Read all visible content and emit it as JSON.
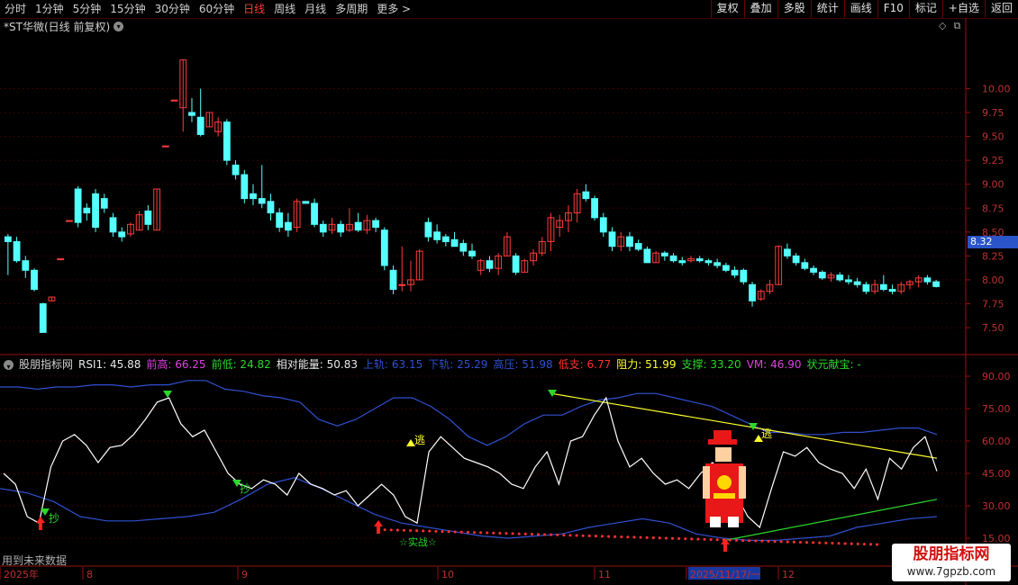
{
  "toolbar": {
    "periods": [
      {
        "label": "分时",
        "active": false
      },
      {
        "label": "1分钟",
        "active": false
      },
      {
        "label": "5分钟",
        "active": false
      },
      {
        "label": "15分钟",
        "active": false
      },
      {
        "label": "30分钟",
        "active": false
      },
      {
        "label": "60分钟",
        "active": false
      },
      {
        "label": "日线",
        "active": true
      },
      {
        "label": "周线",
        "active": false
      },
      {
        "label": "月线",
        "active": false
      },
      {
        "label": "多周期",
        "active": false
      },
      {
        "label": "更多 >",
        "active": false
      }
    ],
    "buttons": [
      "复权",
      "叠加",
      "多股",
      "统计",
      "画线",
      "F10",
      "标记",
      "+自选",
      "返回"
    ]
  },
  "main_title": "*ST华微(日线 前复权)",
  "corner_icons": [
    "diamond-icon",
    "restore-icon"
  ],
  "price_tag": "8.32",
  "indicator": {
    "name": "股朋指标网",
    "fields": [
      {
        "label": "RSI1: 45.88",
        "color": "#e8e8e8"
      },
      {
        "label": "前高: 66.25",
        "color": "#e040e0"
      },
      {
        "label": "前低: 24.82",
        "color": "#2ad82a"
      },
      {
        "label": "相对能量: 50.83",
        "color": "#e8e8e8"
      },
      {
        "label": "上轨: 63.15",
        "color": "#3050d0"
      },
      {
        "label": "下轨: 25.29",
        "color": "#3050d0"
      },
      {
        "label": "高压: 51.98",
        "color": "#3050d0"
      },
      {
        "label": "低支: 6.77",
        "color": "#ff3030"
      },
      {
        "label": "阻力: 51.99",
        "color": "#ffff30"
      },
      {
        "label": "支撑: 33.20",
        "color": "#2ad82a"
      },
      {
        "label": "VM: 46.90",
        "color": "#e040e0"
      },
      {
        "label": "状元献宝: -",
        "color": "#2ad82a"
      }
    ]
  },
  "annotations": {
    "chao": "抄",
    "tao": "逃",
    "shizhan": "☆实战☆"
  },
  "future_note": "用到未来数据",
  "watermark": {
    "line1": "股朋指标网",
    "line2": "www.7gpzb.com"
  },
  "date_axis": {
    "labels": [
      "2025年",
      "8",
      "9",
      "10",
      "11",
      "2025/11/17/一",
      "12"
    ]
  },
  "chart_data": [
    {
      "type": "candlestick",
      "title": "*ST华微(日线 前复权)",
      "y_ticks": [
        7.5,
        7.75,
        8.0,
        8.25,
        8.5,
        8.75,
        9.0,
        9.25,
        9.5,
        9.75,
        10.0
      ],
      "ylim": [
        7.35,
        10.55
      ],
      "colors": {
        "up": "#ff3c3c",
        "down": "#54ffff"
      },
      "candles": [
        [
          8.45,
          8.05,
          8.4,
          8.48
        ],
        [
          8.4,
          8.18,
          8.2,
          8.45
        ],
        [
          8.2,
          8.02,
          8.1,
          8.25
        ],
        [
          8.1,
          7.88,
          7.9,
          8.12
        ],
        [
          7.75,
          7.45,
          7.45,
          7.76
        ],
        [
          7.78,
          7.78,
          7.82,
          7.82
        ],
        [
          8.22,
          8.22,
          8.22,
          8.22
        ],
        [
          8.62,
          8.62,
          8.62,
          8.62
        ],
        [
          8.95,
          8.55,
          8.6,
          8.98
        ],
        [
          8.75,
          8.62,
          8.7,
          8.8
        ],
        [
          8.9,
          8.5,
          8.55,
          8.95
        ],
        [
          8.85,
          8.7,
          8.75,
          8.9
        ],
        [
          8.65,
          8.45,
          8.5,
          8.7
        ],
        [
          8.5,
          8.4,
          8.45,
          8.55
        ],
        [
          8.48,
          8.45,
          8.58,
          8.6
        ],
        [
          8.52,
          8.52,
          8.68,
          8.72
        ],
        [
          8.72,
          8.52,
          8.58,
          8.78
        ],
        [
          8.52,
          8.52,
          8.95,
          8.95
        ],
        [
          9.4,
          9.4,
          9.4,
          9.4
        ],
        [
          9.88,
          9.88,
          9.88,
          9.88
        ],
        [
          9.8,
          9.55,
          10.3,
          10.3
        ],
        [
          9.75,
          9.65,
          9.72,
          9.9
        ],
        [
          9.7,
          9.5,
          9.52,
          10.0
        ],
        [
          9.6,
          9.6,
          9.75,
          9.75
        ],
        [
          9.55,
          9.5,
          9.65,
          9.7
        ],
        [
          9.65,
          9.2,
          9.25,
          9.68
        ],
        [
          9.2,
          9.05,
          9.1,
          9.25
        ],
        [
          9.1,
          8.8,
          8.85,
          9.15
        ],
        [
          8.9,
          8.78,
          8.85,
          9.0
        ],
        [
          8.85,
          8.75,
          8.8,
          9.2
        ],
        [
          8.82,
          8.62,
          8.7,
          8.9
        ],
        [
          8.7,
          8.5,
          8.55,
          8.75
        ],
        [
          8.6,
          8.45,
          8.52,
          8.7
        ],
        [
          8.55,
          8.5,
          8.82,
          8.85
        ],
        [
          8.82,
          8.8,
          8.8,
          8.82
        ],
        [
          8.8,
          8.55,
          8.58,
          8.85
        ],
        [
          8.58,
          8.45,
          8.5,
          8.62
        ],
        [
          8.52,
          8.48,
          8.58,
          8.65
        ],
        [
          8.58,
          8.45,
          8.5,
          8.62
        ],
        [
          8.52,
          8.5,
          8.58,
          8.75
        ],
        [
          8.6,
          8.5,
          8.52,
          8.7
        ],
        [
          8.52,
          8.48,
          8.62,
          8.68
        ],
        [
          8.62,
          8.5,
          8.55,
          8.65
        ],
        [
          8.52,
          8.1,
          8.15,
          8.55
        ],
        [
          8.1,
          7.85,
          7.9,
          8.15
        ],
        [
          7.95,
          7.88,
          7.95,
          8.35
        ],
        [
          7.95,
          7.88,
          8.0,
          8.2
        ],
        [
          8.0,
          8.0,
          8.3,
          8.32
        ],
        [
          8.6,
          8.4,
          8.45,
          8.65
        ],
        [
          8.5,
          8.38,
          8.42,
          8.58
        ],
        [
          8.45,
          8.35,
          8.4,
          8.48
        ],
        [
          8.42,
          8.38,
          8.35,
          8.5
        ],
        [
          8.38,
          8.25,
          8.3,
          8.42
        ],
        [
          8.3,
          8.22,
          8.25,
          8.38
        ],
        [
          8.1,
          8.05,
          8.2,
          8.22
        ],
        [
          8.2,
          8.08,
          8.12,
          8.25
        ],
        [
          8.12,
          8.05,
          8.25,
          8.28
        ],
        [
          8.25,
          8.3,
          8.45,
          8.5
        ],
        [
          8.25,
          8.05,
          8.08,
          8.28
        ],
        [
          8.08,
          8.12,
          8.2,
          8.22
        ],
        [
          8.2,
          8.15,
          8.28,
          8.32
        ],
        [
          8.28,
          8.25,
          8.4,
          8.45
        ],
        [
          8.4,
          8.3,
          8.65,
          8.7
        ],
        [
          8.55,
          8.45,
          8.62,
          8.68
        ],
        [
          8.62,
          8.5,
          8.7,
          8.78
        ],
        [
          8.7,
          8.6,
          8.9,
          8.95
        ],
        [
          8.92,
          8.82,
          8.85,
          9.0
        ],
        [
          8.85,
          8.62,
          8.65,
          8.88
        ],
        [
          8.65,
          8.45,
          8.5,
          8.7
        ],
        [
          8.5,
          8.3,
          8.35,
          8.55
        ],
        [
          8.35,
          8.3,
          8.45,
          8.5
        ],
        [
          8.45,
          8.3,
          8.35,
          8.5
        ],
        [
          8.38,
          8.3,
          8.32,
          8.42
        ],
        [
          8.32,
          8.2,
          8.18,
          8.35
        ],
        [
          8.18,
          8.2,
          8.28,
          8.3
        ],
        [
          8.28,
          8.2,
          8.25,
          8.3
        ],
        [
          8.25,
          8.18,
          8.2,
          8.28
        ],
        [
          8.2,
          8.15,
          8.18,
          8.24
        ],
        [
          8.2,
          8.18,
          8.22,
          8.25
        ],
        [
          8.22,
          8.18,
          8.2,
          8.25
        ],
        [
          8.2,
          8.15,
          8.18,
          8.22
        ],
        [
          8.18,
          8.12,
          8.15,
          8.22
        ],
        [
          8.15,
          8.08,
          8.1,
          8.18
        ],
        [
          8.1,
          8.02,
          8.05,
          8.14
        ],
        [
          8.1,
          7.95,
          7.98,
          8.12
        ],
        [
          7.95,
          7.72,
          7.78,
          7.98
        ],
        [
          7.8,
          7.78,
          7.88,
          7.9
        ],
        [
          7.88,
          7.85,
          7.95,
          8.0
        ],
        [
          7.95,
          7.95,
          8.35,
          8.36
        ],
        [
          8.32,
          8.22,
          8.25,
          8.38
        ],
        [
          8.25,
          8.15,
          8.18,
          8.28
        ],
        [
          8.18,
          8.1,
          8.12,
          8.22
        ],
        [
          8.12,
          8.05,
          8.08,
          8.15
        ],
        [
          8.08,
          8.0,
          8.02,
          8.1
        ],
        [
          8.02,
          7.98,
          8.05,
          8.08
        ],
        [
          8.05,
          7.98,
          8.0,
          8.08
        ],
        [
          8.0,
          7.95,
          7.98,
          8.05
        ],
        [
          7.98,
          7.92,
          7.95,
          8.02
        ],
        [
          7.95,
          7.85,
          7.88,
          7.98
        ],
        [
          7.88,
          7.85,
          7.95,
          8.0
        ],
        [
          7.95,
          7.88,
          7.9,
          8.05
        ],
        [
          7.9,
          7.85,
          7.88,
          7.95
        ],
        [
          7.88,
          7.85,
          7.95,
          7.98
        ],
        [
          7.95,
          7.9,
          7.98,
          8.0
        ],
        [
          7.98,
          7.92,
          8.02,
          8.05
        ],
        [
          8.02,
          7.95,
          7.98,
          8.05
        ],
        [
          7.98,
          7.92,
          7.93,
          8.0
        ]
      ]
    },
    {
      "type": "line",
      "title": "股朋指标网",
      "y_ticks": [
        15.0,
        30.0,
        45.0,
        60.0,
        75.0,
        90.0
      ],
      "ylim": [
        10,
        95
      ],
      "series": [
        {
          "name": "RSI1",
          "color": "#ffffff",
          "values": [
            45,
            40,
            25,
            22,
            48,
            60,
            63,
            58,
            50,
            57,
            58,
            63,
            70,
            78,
            80,
            68,
            62,
            65,
            55,
            45,
            40,
            38,
            42,
            40,
            35,
            45,
            40,
            38,
            35,
            37,
            30,
            35,
            40,
            35,
            25,
            22,
            55,
            62,
            57,
            52,
            50,
            48,
            45,
            40,
            38,
            48,
            55,
            40,
            60,
            62,
            72,
            80,
            60,
            48,
            52,
            45,
            40,
            42,
            38,
            45,
            50,
            45,
            35,
            25,
            20,
            38,
            55,
            53,
            57,
            50,
            47,
            45,
            38,
            47,
            33,
            52,
            47,
            57,
            62,
            46
          ]
        },
        {
          "name": "上轨",
          "color": "#3050d0",
          "values": [
            85,
            85,
            84,
            85,
            85,
            86,
            86,
            85,
            86,
            86,
            88,
            88,
            84,
            83,
            81,
            80,
            78,
            70,
            67,
            70,
            75,
            80,
            80,
            76,
            70,
            62,
            58,
            62,
            68,
            72,
            72,
            76,
            79,
            80,
            82,
            82,
            80,
            78,
            76,
            72,
            68,
            64,
            64,
            63,
            63,
            64,
            64,
            65,
            66,
            66,
            63
          ]
        },
        {
          "name": "下轨",
          "color": "#3050d0",
          "values": [
            38,
            36,
            32,
            25,
            23,
            23,
            24,
            25,
            27,
            33,
            40,
            43,
            38,
            32,
            26,
            22,
            20,
            18,
            16,
            15,
            16,
            17,
            20,
            22,
            24,
            22,
            17,
            15,
            14,
            14,
            15,
            16,
            20,
            22,
            24,
            25
          ]
        },
        {
          "name": "阻力",
          "color": "#ffff30",
          "values": [
            82,
            52
          ]
        },
        {
          "name": "支撑",
          "color": "#2ad82a",
          "values": [
            14,
            33
          ]
        },
        {
          "name": "低支",
          "color": "#ff3030",
          "values": [
            19,
            12
          ]
        }
      ]
    }
  ]
}
